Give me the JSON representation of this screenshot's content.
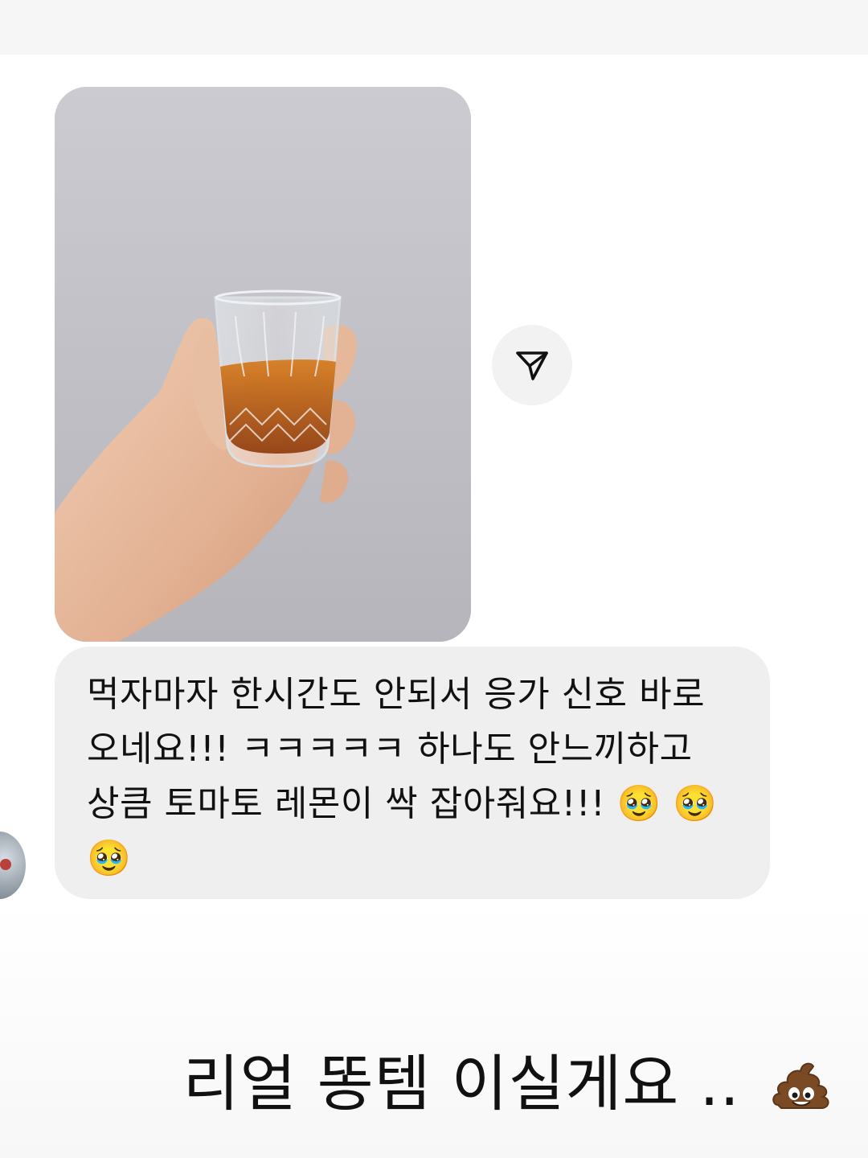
{
  "conversation": {
    "photo_message": {
      "content": "photo of a hand holding a small glass with amber liquid",
      "icon": "photo"
    },
    "share_button": {
      "icon": "send-triangle-icon"
    },
    "avatar": {
      "icon": "profile-avatar"
    },
    "received_message": {
      "text": "먹자마자 한시간도 안되서 응가 신호 바로 오네요!!! ㅋㅋㅋㅋㅋ 하나도 안느끼하고 상큼 토마토 레몬이 싹 잡아줘요!!! 🥹 🥹 🥹"
    },
    "reply": {
      "text": "리얼 똥템 이실게요 ..",
      "emoji": "poo-emoji"
    }
  },
  "colors": {
    "bubble": "#efefef",
    "share_button": "#f2f2f2",
    "text": "#111111",
    "liquid": "#b4520f"
  }
}
